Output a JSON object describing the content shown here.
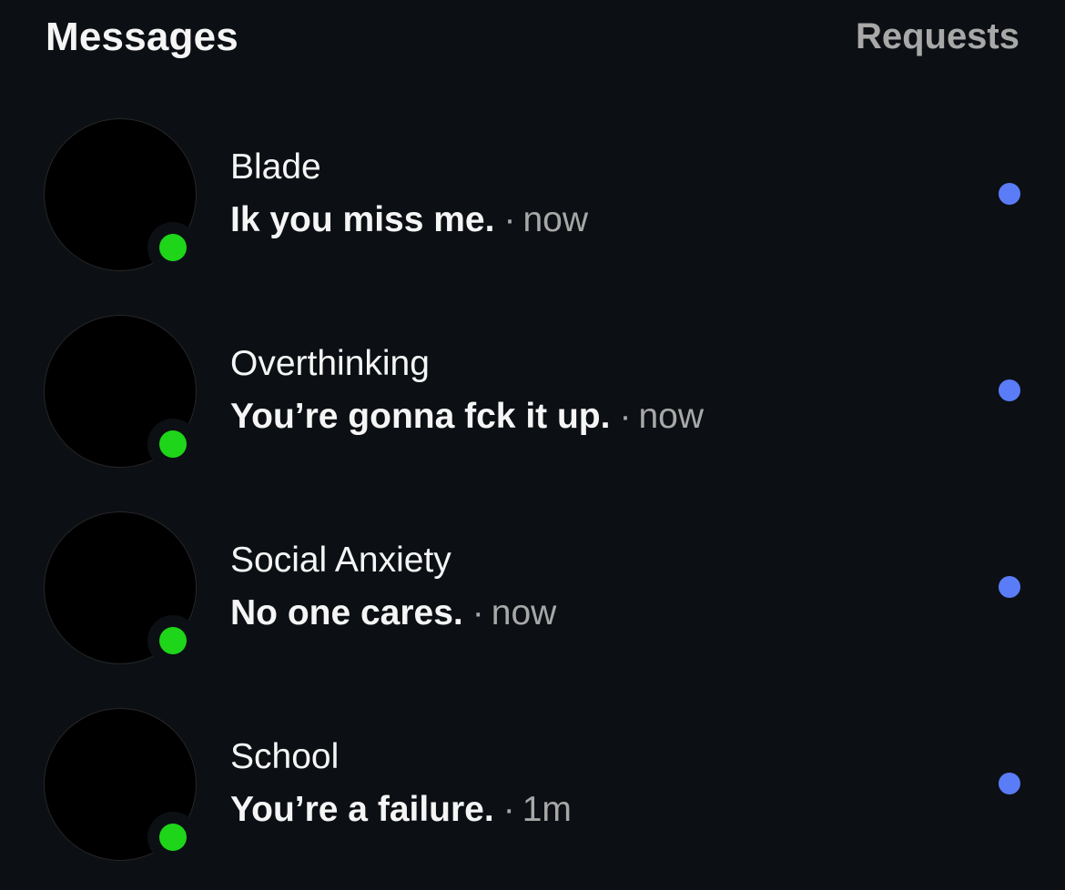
{
  "header": {
    "title": "Messages",
    "requests_label": "Requests"
  },
  "colors": {
    "background": "#0c1014",
    "presence": "#1ed51a",
    "unread_dot": "#5b7cf7",
    "muted_text": "#a8a8a8"
  },
  "conversations": [
    {
      "name": "Blade",
      "message": "Ik you miss me.",
      "separator": "·",
      "time": "now",
      "online": true,
      "unread": true
    },
    {
      "name": "Overthinking",
      "message": "You’re gonna fck it up.",
      "separator": "·",
      "time": "now",
      "online": true,
      "unread": true
    },
    {
      "name": "Social Anxiety",
      "message": "No one cares.",
      "separator": "·",
      "time": "now",
      "online": true,
      "unread": true
    },
    {
      "name": "School",
      "message": "You’re a failure.",
      "separator": "·",
      "time": "1m",
      "online": true,
      "unread": true
    }
  ]
}
